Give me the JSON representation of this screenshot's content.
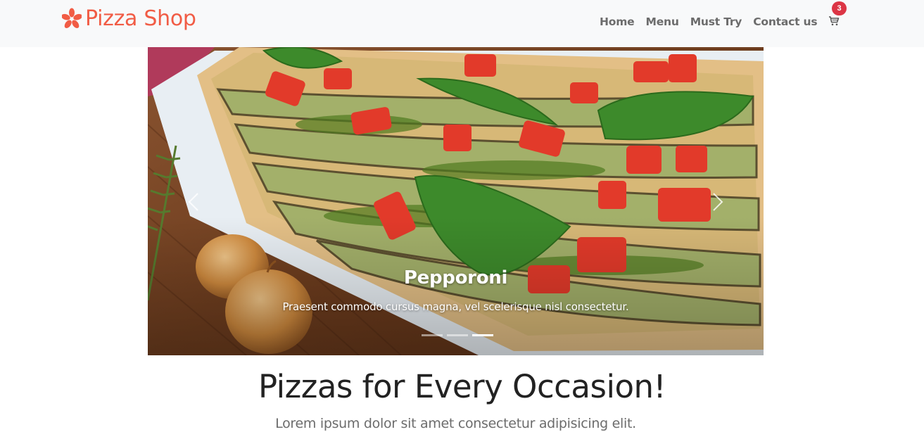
{
  "navbar": {
    "brand": "Pizza Shop",
    "brand_icon": "pizza-flower-icon",
    "brand_color": "#f15c45",
    "links": [
      {
        "label": "Home"
      },
      {
        "label": "Menu"
      },
      {
        "label": "Must Try"
      },
      {
        "label": "Contact us"
      }
    ],
    "cart": {
      "icon": "cart-icon",
      "count": "3",
      "badge_color": "#dc3545"
    }
  },
  "carousel": {
    "active_slide": 3,
    "slide_count": 3,
    "caption_title": "Pepporoni",
    "caption_text": "Praesent commodo cursus magna, vel scelerisque nisl consectetur.",
    "prev_icon": "chevron-left-icon",
    "next_icon": "chevron-right-icon"
  },
  "hero": {
    "heading": "Pizzas for Every Occasion!",
    "subtext": "Lorem ipsum dolor sit amet consectetur adipisicing elit."
  }
}
